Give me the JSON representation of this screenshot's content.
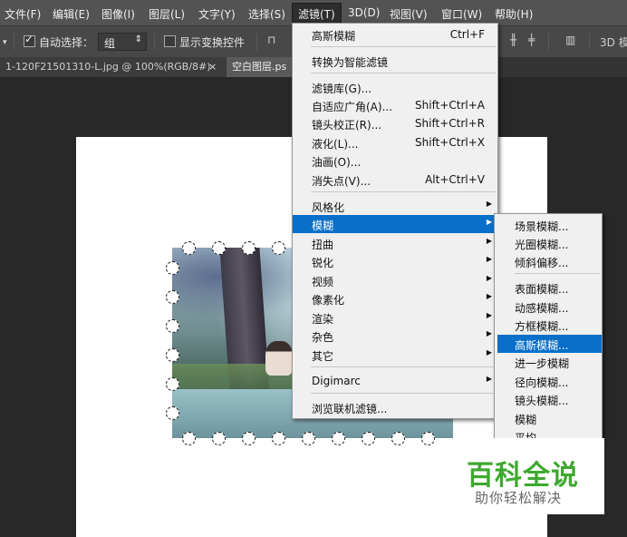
{
  "menubar": {
    "items": [
      {
        "label": "文件(F)"
      },
      {
        "label": "编辑(E)"
      },
      {
        "label": "图像(I)"
      },
      {
        "label": "图层(L)"
      },
      {
        "label": "文字(Y)"
      },
      {
        "label": "选择(S)"
      },
      {
        "label": "滤镜(T)"
      },
      {
        "label": "3D(D)"
      },
      {
        "label": "视图(V)"
      },
      {
        "label": "窗口(W)"
      },
      {
        "label": "帮助(H)"
      }
    ]
  },
  "options": {
    "auto_select_label": "自动选择：",
    "auto_select_value": "组",
    "show_transform_label": "显示变换控件",
    "mode_3d": "3D 模"
  },
  "tabs": [
    {
      "label": "1-120F21501310-L.jpg @ 100%(RGB/8#)",
      "close": "×"
    },
    {
      "label": "空白图层.ps"
    }
  ],
  "filter_menu": {
    "items": [
      {
        "label": "高斯模糊",
        "shortcut": "Ctrl+F"
      },
      {
        "label": "转换为智能滤镜"
      },
      {
        "label": "滤镜库(G)..."
      },
      {
        "label": "自适应广角(A)...",
        "shortcut": "Shift+Ctrl+A"
      },
      {
        "label": "镜头校正(R)...",
        "shortcut": "Shift+Ctrl+R"
      },
      {
        "label": "液化(L)...",
        "shortcut": "Shift+Ctrl+X"
      },
      {
        "label": "油画(O)..."
      },
      {
        "label": "消失点(V)...",
        "shortcut": "Alt+Ctrl+V"
      },
      {
        "label": "风格化"
      },
      {
        "label": "模糊"
      },
      {
        "label": "扭曲"
      },
      {
        "label": "锐化"
      },
      {
        "label": "视频"
      },
      {
        "label": "像素化"
      },
      {
        "label": "渲染"
      },
      {
        "label": "杂色"
      },
      {
        "label": "其它"
      },
      {
        "label": "Digimarc"
      },
      {
        "label": "浏览联机滤镜..."
      }
    ]
  },
  "blur_submenu": {
    "items": [
      {
        "label": "场景模糊..."
      },
      {
        "label": "光圈模糊..."
      },
      {
        "label": "倾斜偏移..."
      },
      {
        "label": "表面模糊..."
      },
      {
        "label": "动感模糊..."
      },
      {
        "label": "方框模糊..."
      },
      {
        "label": "高斯模糊..."
      },
      {
        "label": "进一步模糊"
      },
      {
        "label": "径向模糊..."
      },
      {
        "label": "镜头模糊..."
      },
      {
        "label": "模糊"
      },
      {
        "label": "平均"
      }
    ]
  },
  "watermark": {
    "title": "百科全说",
    "subtitle": "助你轻松解决"
  },
  "colors": {
    "highlight": "#0a6fc8",
    "watermark_green": "#3ea82f"
  }
}
